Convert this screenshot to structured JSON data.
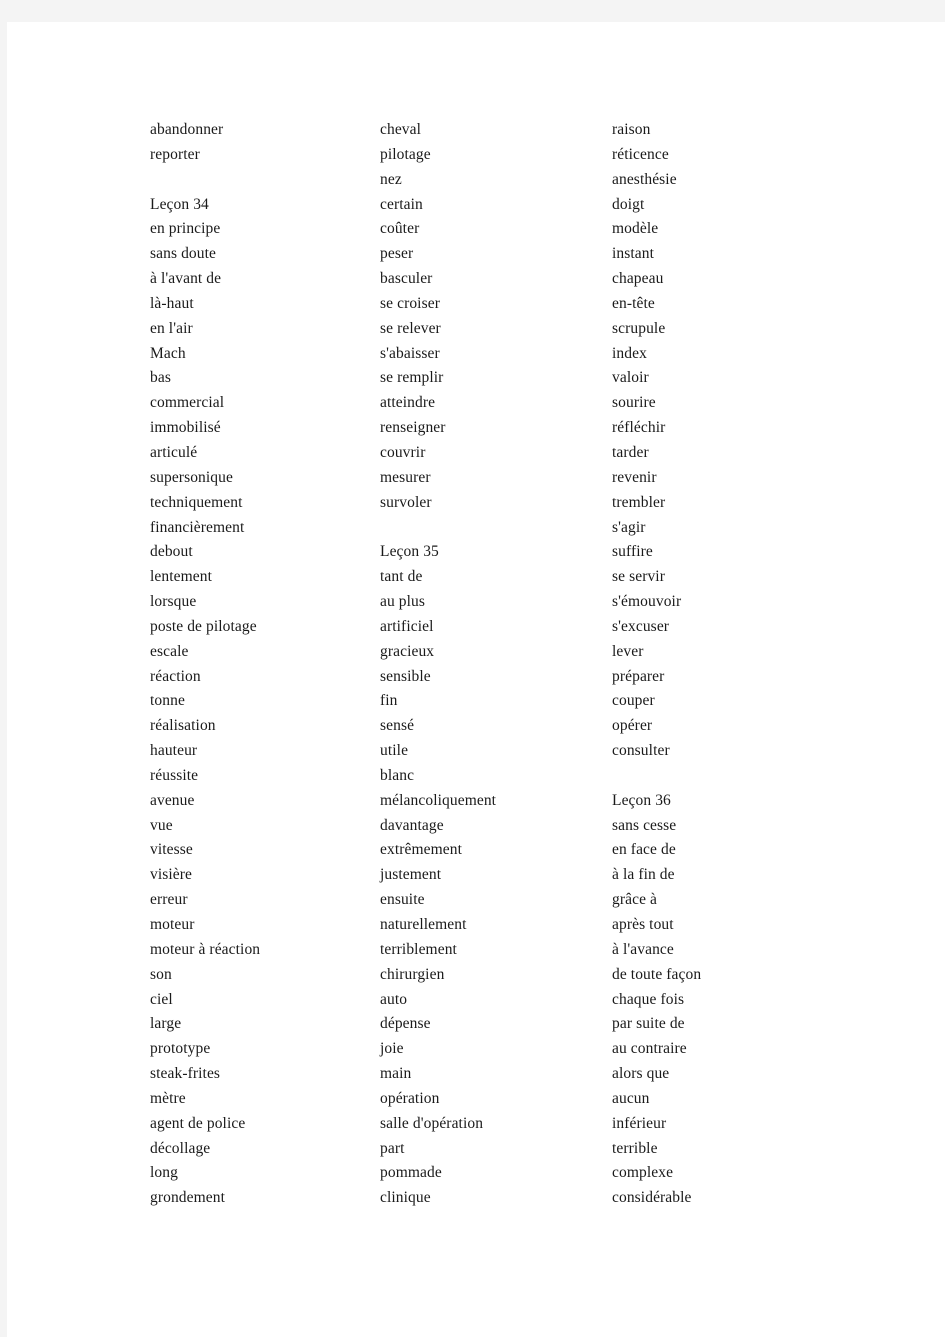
{
  "document": {
    "type": "vocabulary-list",
    "language": "French",
    "page_background": "#ffffff",
    "surround_background": "#f4f4f4",
    "text_color": "#1a1a1a"
  },
  "columns": [
    {
      "name": "column-1",
      "entries": [
        {
          "text": "abandonner",
          "kind": "word"
        },
        {
          "text": "reporter",
          "kind": "word"
        },
        {
          "text": "",
          "kind": "blank"
        },
        {
          "text": "Leçon 34",
          "kind": "lesson"
        },
        {
          "text": "en principe",
          "kind": "word"
        },
        {
          "text": "sans doute",
          "kind": "word"
        },
        {
          "text": "à l'avant de",
          "kind": "word"
        },
        {
          "text": "là-haut",
          "kind": "word"
        },
        {
          "text": "en l'air",
          "kind": "word"
        },
        {
          "text": "Mach",
          "kind": "word"
        },
        {
          "text": "bas",
          "kind": "word"
        },
        {
          "text": "commercial",
          "kind": "word"
        },
        {
          "text": "immobilisé",
          "kind": "word"
        },
        {
          "text": "articulé",
          "kind": "word"
        },
        {
          "text": "supersonique",
          "kind": "word"
        },
        {
          "text": "techniquement",
          "kind": "word"
        },
        {
          "text": "financièrement",
          "kind": "word"
        },
        {
          "text": "debout",
          "kind": "word"
        },
        {
          "text": "lentement",
          "kind": "word"
        },
        {
          "text": "lorsque",
          "kind": "word"
        },
        {
          "text": "poste de pilotage",
          "kind": "word"
        },
        {
          "text": "escale",
          "kind": "word"
        },
        {
          "text": "réaction",
          "kind": "word"
        },
        {
          "text": "tonne",
          "kind": "word"
        },
        {
          "text": "réalisation",
          "kind": "word"
        },
        {
          "text": "hauteur",
          "kind": "word"
        },
        {
          "text": "réussite",
          "kind": "word"
        },
        {
          "text": "avenue",
          "kind": "word"
        },
        {
          "text": "vue",
          "kind": "word"
        },
        {
          "text": "vitesse",
          "kind": "word"
        },
        {
          "text": "visière",
          "kind": "word"
        },
        {
          "text": "erreur",
          "kind": "word"
        },
        {
          "text": "moteur",
          "kind": "word"
        },
        {
          "text": "moteur à réaction",
          "kind": "word"
        },
        {
          "text": "son",
          "kind": "word"
        },
        {
          "text": "ciel",
          "kind": "word"
        },
        {
          "text": "large",
          "kind": "word"
        },
        {
          "text": "prototype",
          "kind": "word"
        },
        {
          "text": "steak-frites",
          "kind": "word"
        },
        {
          "text": "mètre",
          "kind": "word"
        },
        {
          "text": "agent de police",
          "kind": "word"
        },
        {
          "text": "décollage",
          "kind": "word"
        },
        {
          "text": "long",
          "kind": "word"
        },
        {
          "text": "grondement",
          "kind": "word"
        }
      ]
    },
    {
      "name": "column-2",
      "entries": [
        {
          "text": "cheval",
          "kind": "word"
        },
        {
          "text": "pilotage",
          "kind": "word"
        },
        {
          "text": "nez",
          "kind": "word"
        },
        {
          "text": "certain",
          "kind": "word"
        },
        {
          "text": "coûter",
          "kind": "word"
        },
        {
          "text": "peser",
          "kind": "word"
        },
        {
          "text": "basculer",
          "kind": "word"
        },
        {
          "text": "se croiser",
          "kind": "word"
        },
        {
          "text": "se relever",
          "kind": "word"
        },
        {
          "text": "s'abaisser",
          "kind": "word"
        },
        {
          "text": "se remplir",
          "kind": "word"
        },
        {
          "text": "atteindre",
          "kind": "word"
        },
        {
          "text": "renseigner",
          "kind": "word"
        },
        {
          "text": "couvrir",
          "kind": "word"
        },
        {
          "text": "mesurer",
          "kind": "word"
        },
        {
          "text": "survoler",
          "kind": "word"
        },
        {
          "text": "",
          "kind": "blank"
        },
        {
          "text": "Leçon 35",
          "kind": "lesson"
        },
        {
          "text": "tant de",
          "kind": "word"
        },
        {
          "text": "au plus",
          "kind": "word"
        },
        {
          "text": "artificiel",
          "kind": "word"
        },
        {
          "text": "gracieux",
          "kind": "word"
        },
        {
          "text": "sensible",
          "kind": "word"
        },
        {
          "text": "fin",
          "kind": "word"
        },
        {
          "text": "sensé",
          "kind": "word"
        },
        {
          "text": "utile",
          "kind": "word"
        },
        {
          "text": "blanc",
          "kind": "word"
        },
        {
          "text": "mélancoliquement",
          "kind": "word"
        },
        {
          "text": "davantage",
          "kind": "word"
        },
        {
          "text": "extrêmement",
          "kind": "word"
        },
        {
          "text": "justement",
          "kind": "word"
        },
        {
          "text": "ensuite",
          "kind": "word"
        },
        {
          "text": "naturellement",
          "kind": "word"
        },
        {
          "text": "terriblement",
          "kind": "word"
        },
        {
          "text": "chirurgien",
          "kind": "word"
        },
        {
          "text": "auto",
          "kind": "word"
        },
        {
          "text": "dépense",
          "kind": "word"
        },
        {
          "text": "joie",
          "kind": "word"
        },
        {
          "text": "main",
          "kind": "word"
        },
        {
          "text": "opération",
          "kind": "word"
        },
        {
          "text": "salle d'opération",
          "kind": "word"
        },
        {
          "text": "part",
          "kind": "word"
        },
        {
          "text": "pommade",
          "kind": "word"
        },
        {
          "text": "clinique",
          "kind": "word"
        }
      ]
    },
    {
      "name": "column-3",
      "entries": [
        {
          "text": "raison",
          "kind": "word"
        },
        {
          "text": "réticence",
          "kind": "word"
        },
        {
          "text": "anesthésie",
          "kind": "word"
        },
        {
          "text": "doigt",
          "kind": "word"
        },
        {
          "text": "modèle",
          "kind": "word"
        },
        {
          "text": "instant",
          "kind": "word"
        },
        {
          "text": "chapeau",
          "kind": "word"
        },
        {
          "text": "en-tête",
          "kind": "word"
        },
        {
          "text": "scrupule",
          "kind": "word"
        },
        {
          "text": "index",
          "kind": "word"
        },
        {
          "text": "valoir",
          "kind": "word"
        },
        {
          "text": "sourire",
          "kind": "word"
        },
        {
          "text": "réfléchir",
          "kind": "word"
        },
        {
          "text": "tarder",
          "kind": "word"
        },
        {
          "text": "revenir",
          "kind": "word"
        },
        {
          "text": "trembler",
          "kind": "word"
        },
        {
          "text": "s'agir",
          "kind": "word"
        },
        {
          "text": "suffire",
          "kind": "word"
        },
        {
          "text": "se servir",
          "kind": "word"
        },
        {
          "text": "s'émouvoir",
          "kind": "word"
        },
        {
          "text": "s'excuser",
          "kind": "word"
        },
        {
          "text": "lever",
          "kind": "word"
        },
        {
          "text": "préparer",
          "kind": "word"
        },
        {
          "text": "couper",
          "kind": "word"
        },
        {
          "text": "opérer",
          "kind": "word"
        },
        {
          "text": "consulter",
          "kind": "word"
        },
        {
          "text": "",
          "kind": "blank"
        },
        {
          "text": "Leçon 36",
          "kind": "lesson"
        },
        {
          "text": "sans cesse",
          "kind": "word"
        },
        {
          "text": "en face de",
          "kind": "word"
        },
        {
          "text": "à la fin de",
          "kind": "word"
        },
        {
          "text": "grâce à",
          "kind": "word"
        },
        {
          "text": "après tout",
          "kind": "word"
        },
        {
          "text": "à l'avance",
          "kind": "word"
        },
        {
          "text": "de toute façon",
          "kind": "word"
        },
        {
          "text": "chaque fois",
          "kind": "word"
        },
        {
          "text": "par suite de",
          "kind": "word"
        },
        {
          "text": "au contraire",
          "kind": "word"
        },
        {
          "text": "alors que",
          "kind": "word"
        },
        {
          "text": "aucun",
          "kind": "word"
        },
        {
          "text": "inférieur",
          "kind": "word"
        },
        {
          "text": "terrible",
          "kind": "word"
        },
        {
          "text": "complexe",
          "kind": "word"
        },
        {
          "text": "considérable",
          "kind": "word"
        }
      ]
    }
  ]
}
